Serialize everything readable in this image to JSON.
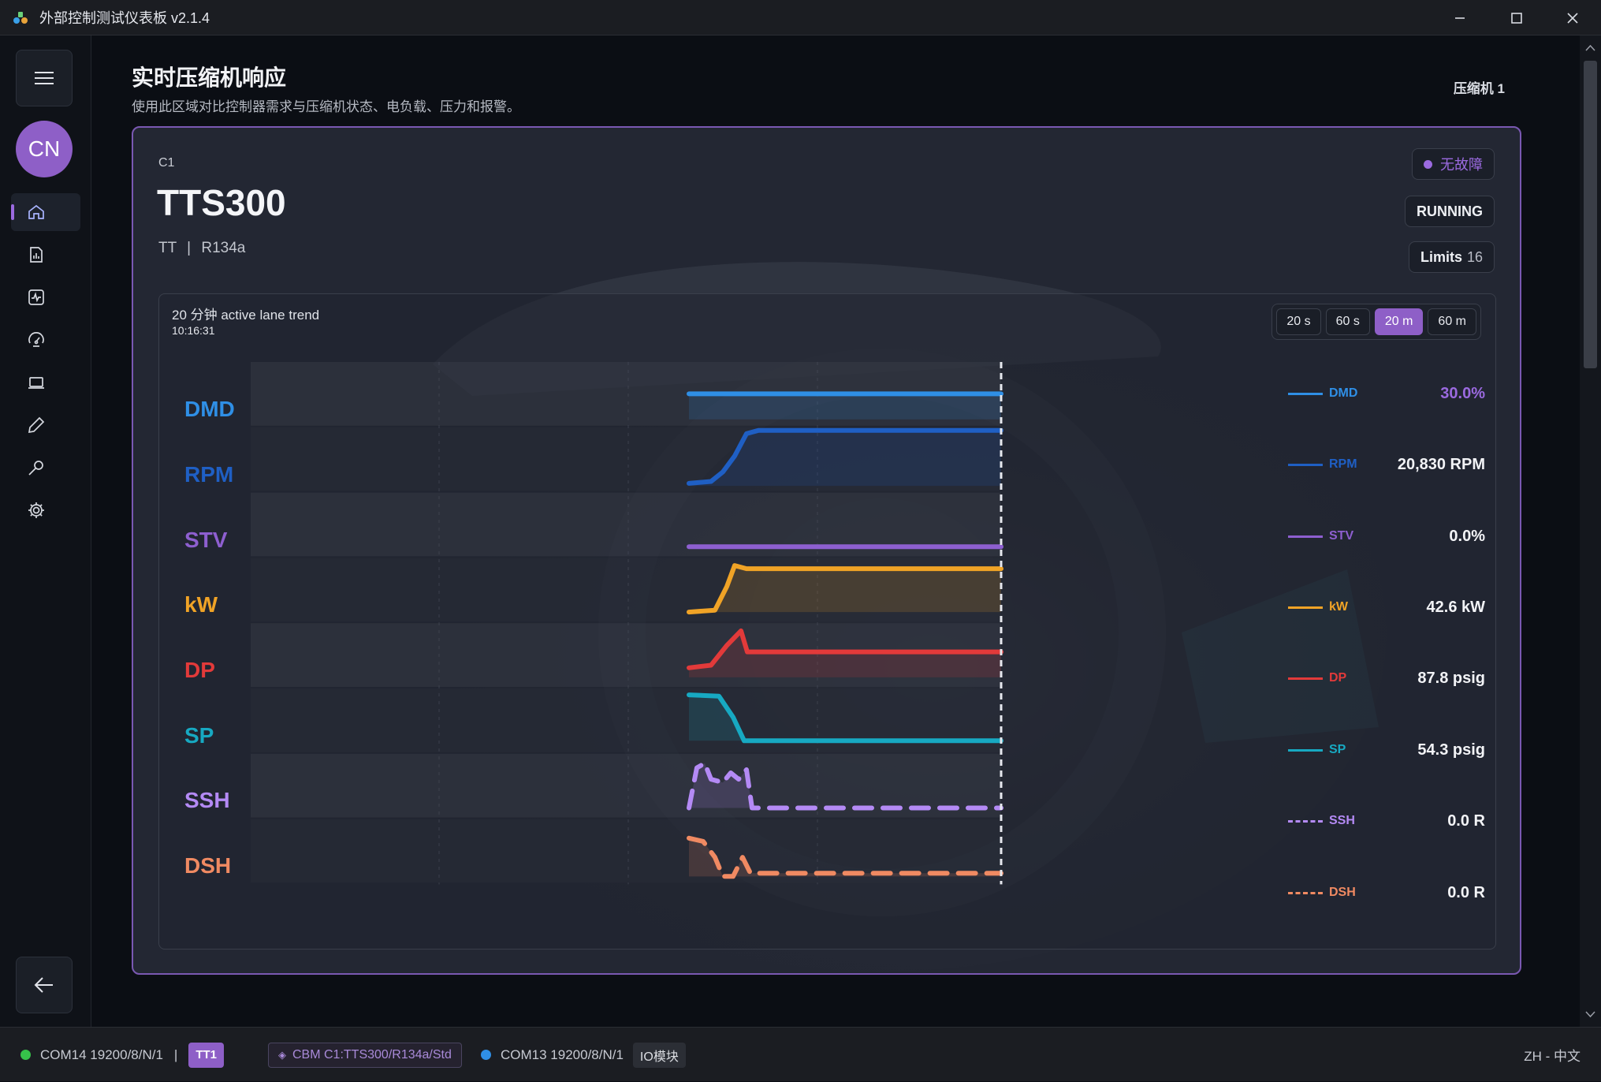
{
  "window": {
    "title": "外部控制测试仪表板 v2.1.4"
  },
  "sidebar": {
    "avatar_initials": "CN",
    "items": [
      {
        "name": "home",
        "icon": "home-icon",
        "active": true
      },
      {
        "name": "reports",
        "icon": "report-chart-icon",
        "active": false
      },
      {
        "name": "monitor",
        "icon": "pulse-monitor-icon",
        "active": false
      },
      {
        "name": "gauge",
        "icon": "gauge-icon",
        "active": false
      },
      {
        "name": "device",
        "icon": "laptop-icon",
        "active": false
      },
      {
        "name": "edit",
        "icon": "pen-icon",
        "active": false
      },
      {
        "name": "tools",
        "icon": "wrench-icon",
        "active": false
      },
      {
        "name": "settings",
        "icon": "gear-icon",
        "active": false
      }
    ]
  },
  "header": {
    "title": "实时压缩机响应",
    "subtitle": "使用此区域对比控制器需求与压缩机状态、电负载、压力和报警。",
    "compressor": "压缩机 1"
  },
  "card": {
    "code": "C1",
    "model": "TTS300",
    "type": "TT",
    "separator": "|",
    "refrigerant": "R134a",
    "fault_status": "无故障",
    "run_status": "RUNNING",
    "limits_label": "Limits",
    "limits_count": "16"
  },
  "trend": {
    "title": "20 分钟 active lane trend",
    "time": "10:16:31",
    "ranges": [
      {
        "label": "20 s",
        "active": false
      },
      {
        "label": "60 s",
        "active": false
      },
      {
        "label": "20 m",
        "active": true
      },
      {
        "label": "60 m",
        "active": false
      }
    ]
  },
  "chart_data": {
    "type": "line",
    "window": "20 m",
    "series": [
      {
        "name": "DMD",
        "color": "#2f8fe6",
        "dashed": false,
        "value": "30.0%",
        "value_color": "#9b6ae0"
      },
      {
        "name": "RPM",
        "color": "#1f5fc4",
        "dashed": false,
        "value": "20,830 RPM",
        "value_color": "#f2f3f6"
      },
      {
        "name": "STV",
        "color": "#8e5fd0",
        "dashed": false,
        "value": "0.0%",
        "value_color": "#f2f3f6"
      },
      {
        "name": "kW",
        "color": "#f0a326",
        "dashed": false,
        "value": "42.6 kW",
        "value_color": "#f2f3f6"
      },
      {
        "name": "DP",
        "color": "#e23a3a",
        "dashed": false,
        "value": "87.8 psig",
        "value_color": "#f2f3f6"
      },
      {
        "name": "SP",
        "color": "#17a9c2",
        "dashed": false,
        "value": "54.3 psig",
        "value_color": "#f2f3f6"
      },
      {
        "name": "SSH",
        "color": "#b48af5",
        "dashed": true,
        "value": "0.0 R",
        "value_color": "#f2f3f6"
      },
      {
        "name": "DSH",
        "color": "#f08a62",
        "dashed": true,
        "value": "0.0 R",
        "value_color": "#f2f3f6"
      }
    ]
  },
  "statusbar": {
    "com1": "COM14 19200/8/N/1",
    "com1_color": "#36c24a",
    "separator": "|",
    "tt_chip": "TT1",
    "cbm": "CBM C1:TTS300/R134a/Std",
    "com2": "COM13 19200/8/N/1",
    "com2_color": "#2f8fe6",
    "io_chip": "IO模块",
    "language": "ZH - 中文"
  }
}
